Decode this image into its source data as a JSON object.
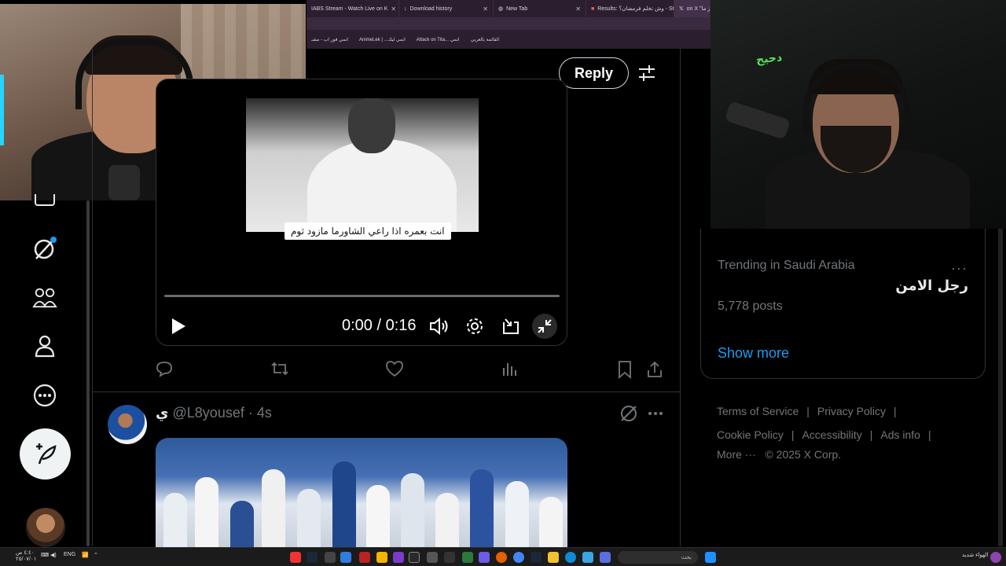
{
  "browser": {
    "tabs": [
      {
        "label": "IABS Stream - Watch Live on K",
        "active": false
      },
      {
        "label": "Download history",
        "active": false
      },
      {
        "label": "New Tab",
        "active": false
      },
      {
        "label": "Results: وش تخلم فرمضان؟ - St",
        "active": false
      },
      {
        "label": "on X \"ميمز ما",
        "active": true
      }
    ],
    "bookmarks": [
      "انمي فور اب - مشـ",
      "AnimeLek | ...انمي ليك",
      "Attack on Tita... انمي",
      "القائمة بالعربي"
    ]
  },
  "thread": {
    "reply_label": "Reply"
  },
  "video": {
    "subtitle": "انت بعمره اذا راعي الشاورما مازود ثوم",
    "time": "0:00 / 0:16",
    "progress": 0
  },
  "tweet2": {
    "name": "ي",
    "handle": "@L8yousef",
    "time": "· 4s"
  },
  "trend": {
    "meta": "Trending in Saudi Arabia",
    "name": "رجل الامن",
    "count": "5,778 posts",
    "more": "···"
  },
  "show_more": "Show more",
  "footer": {
    "terms": "Terms of Service",
    "privacy": "Privacy Policy",
    "cookie": "Cookie Policy",
    "accessibility": "Accessibility",
    "ads": "Ads info",
    "more": "More ···",
    "copyright": "© 2025 X Corp.",
    "sep": "|"
  },
  "taskbar": {
    "clock_time": "٤:٤٠ ص",
    "clock_date": "٢٥/٠٧/٠١",
    "lang": "ENG",
    "search_placeholder": "بحث",
    "weather": "الهواء شديد"
  },
  "cam_logo": "دحيح",
  "colors": {
    "accent": "#1d9bf0",
    "background": "#000000",
    "border": "#2f3336",
    "muted": "#71767b",
    "text": "#e7e9ea"
  }
}
